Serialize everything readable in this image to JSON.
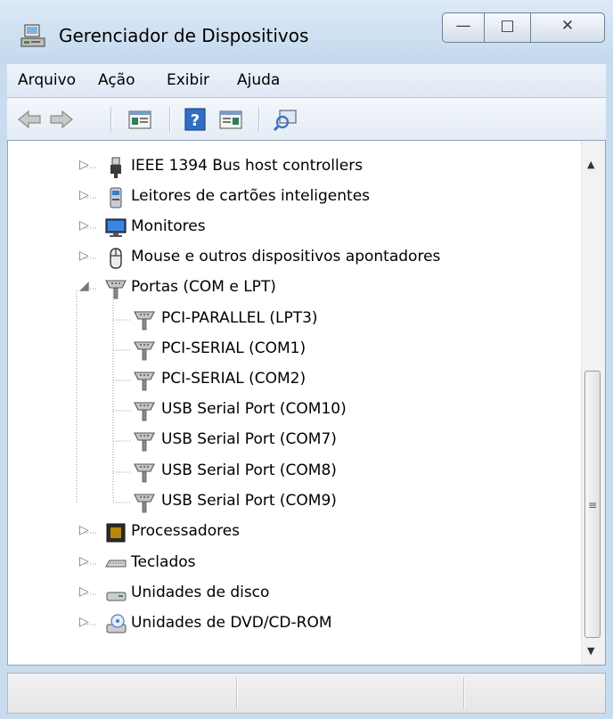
{
  "window": {
    "title": "Gerenciador de Dispositivos"
  },
  "caption": {
    "minimize_glyph": "—",
    "maximize_glyph": "□",
    "close_glyph": "✕"
  },
  "menu": {
    "items": [
      {
        "label": "Arquivo"
      },
      {
        "label": "Ação"
      },
      {
        "label": "Exibir"
      },
      {
        "label": "Ajuda"
      }
    ]
  },
  "toolbar": {
    "buttons": [
      {
        "icon": "back-arrow-icon"
      },
      {
        "icon": "forward-arrow-icon"
      },
      {
        "icon": "properties-icon"
      },
      {
        "icon": "help-icon"
      },
      {
        "icon": "update-driver-icon"
      },
      {
        "icon": "scan-hardware-icon"
      }
    ]
  },
  "tree": {
    "expand_glyph": "▷",
    "collapse_glyph": "◢",
    "nodes": [
      {
        "label": "IEEE 1394 Bus host controllers",
        "icon": "firewire-icon"
      },
      {
        "label": "Leitores de cartões inteligentes",
        "icon": "smartcard-reader-icon"
      },
      {
        "label": "Monitores",
        "icon": "monitor-icon"
      },
      {
        "label": "Mouse e outros dispositivos apontadores",
        "icon": "mouse-icon"
      },
      {
        "label": "Portas (COM e LPT)",
        "icon": "port-icon",
        "expanded": true
      },
      {
        "label": "Processadores",
        "icon": "processor-icon"
      },
      {
        "label": "Teclados",
        "icon": "keyboard-icon"
      },
      {
        "label": "Unidades de disco",
        "icon": "disk-drive-icon"
      },
      {
        "label": "Unidades de DVD/CD-ROM",
        "icon": "dvd-drive-icon"
      }
    ],
    "ports": [
      {
        "label": "PCI-PARALLEL (LPT3)"
      },
      {
        "label": "PCI-SERIAL (COM1)"
      },
      {
        "label": "PCI-SERIAL (COM2)"
      },
      {
        "label": "USB Serial Port (COM10)"
      },
      {
        "label": "USB Serial Port (COM7)"
      },
      {
        "label": "USB Serial Port (COM8)"
      },
      {
        "label": "USB Serial Port (COM9)"
      }
    ]
  },
  "scrollbar": {
    "up_glyph": "▲",
    "down_glyph": "▼",
    "grip_glyph": "≡"
  }
}
